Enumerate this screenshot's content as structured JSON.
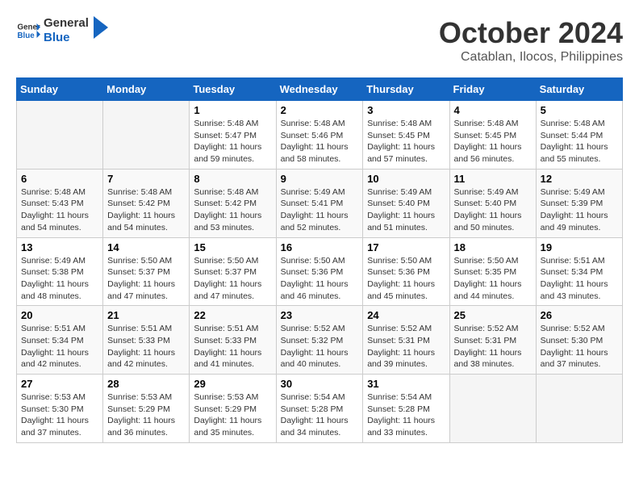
{
  "header": {
    "logo_line1": "General",
    "logo_line2": "Blue",
    "month_year": "October 2024",
    "location": "Catablan, Ilocos, Philippines"
  },
  "weekdays": [
    "Sunday",
    "Monday",
    "Tuesday",
    "Wednesday",
    "Thursday",
    "Friday",
    "Saturday"
  ],
  "weeks": [
    [
      {
        "day": "",
        "info": ""
      },
      {
        "day": "",
        "info": ""
      },
      {
        "day": "1",
        "info": "Sunrise: 5:48 AM\nSunset: 5:47 PM\nDaylight: 11 hours and 59 minutes."
      },
      {
        "day": "2",
        "info": "Sunrise: 5:48 AM\nSunset: 5:46 PM\nDaylight: 11 hours and 58 minutes."
      },
      {
        "day": "3",
        "info": "Sunrise: 5:48 AM\nSunset: 5:45 PM\nDaylight: 11 hours and 57 minutes."
      },
      {
        "day": "4",
        "info": "Sunrise: 5:48 AM\nSunset: 5:45 PM\nDaylight: 11 hours and 56 minutes."
      },
      {
        "day": "5",
        "info": "Sunrise: 5:48 AM\nSunset: 5:44 PM\nDaylight: 11 hours and 55 minutes."
      }
    ],
    [
      {
        "day": "6",
        "info": "Sunrise: 5:48 AM\nSunset: 5:43 PM\nDaylight: 11 hours and 54 minutes."
      },
      {
        "day": "7",
        "info": "Sunrise: 5:48 AM\nSunset: 5:42 PM\nDaylight: 11 hours and 54 minutes."
      },
      {
        "day": "8",
        "info": "Sunrise: 5:48 AM\nSunset: 5:42 PM\nDaylight: 11 hours and 53 minutes."
      },
      {
        "day": "9",
        "info": "Sunrise: 5:49 AM\nSunset: 5:41 PM\nDaylight: 11 hours and 52 minutes."
      },
      {
        "day": "10",
        "info": "Sunrise: 5:49 AM\nSunset: 5:40 PM\nDaylight: 11 hours and 51 minutes."
      },
      {
        "day": "11",
        "info": "Sunrise: 5:49 AM\nSunset: 5:40 PM\nDaylight: 11 hours and 50 minutes."
      },
      {
        "day": "12",
        "info": "Sunrise: 5:49 AM\nSunset: 5:39 PM\nDaylight: 11 hours and 49 minutes."
      }
    ],
    [
      {
        "day": "13",
        "info": "Sunrise: 5:49 AM\nSunset: 5:38 PM\nDaylight: 11 hours and 48 minutes."
      },
      {
        "day": "14",
        "info": "Sunrise: 5:50 AM\nSunset: 5:37 PM\nDaylight: 11 hours and 47 minutes."
      },
      {
        "day": "15",
        "info": "Sunrise: 5:50 AM\nSunset: 5:37 PM\nDaylight: 11 hours and 47 minutes."
      },
      {
        "day": "16",
        "info": "Sunrise: 5:50 AM\nSunset: 5:36 PM\nDaylight: 11 hours and 46 minutes."
      },
      {
        "day": "17",
        "info": "Sunrise: 5:50 AM\nSunset: 5:36 PM\nDaylight: 11 hours and 45 minutes."
      },
      {
        "day": "18",
        "info": "Sunrise: 5:50 AM\nSunset: 5:35 PM\nDaylight: 11 hours and 44 minutes."
      },
      {
        "day": "19",
        "info": "Sunrise: 5:51 AM\nSunset: 5:34 PM\nDaylight: 11 hours and 43 minutes."
      }
    ],
    [
      {
        "day": "20",
        "info": "Sunrise: 5:51 AM\nSunset: 5:34 PM\nDaylight: 11 hours and 42 minutes."
      },
      {
        "day": "21",
        "info": "Sunrise: 5:51 AM\nSunset: 5:33 PM\nDaylight: 11 hours and 42 minutes."
      },
      {
        "day": "22",
        "info": "Sunrise: 5:51 AM\nSunset: 5:33 PM\nDaylight: 11 hours and 41 minutes."
      },
      {
        "day": "23",
        "info": "Sunrise: 5:52 AM\nSunset: 5:32 PM\nDaylight: 11 hours and 40 minutes."
      },
      {
        "day": "24",
        "info": "Sunrise: 5:52 AM\nSunset: 5:31 PM\nDaylight: 11 hours and 39 minutes."
      },
      {
        "day": "25",
        "info": "Sunrise: 5:52 AM\nSunset: 5:31 PM\nDaylight: 11 hours and 38 minutes."
      },
      {
        "day": "26",
        "info": "Sunrise: 5:52 AM\nSunset: 5:30 PM\nDaylight: 11 hours and 37 minutes."
      }
    ],
    [
      {
        "day": "27",
        "info": "Sunrise: 5:53 AM\nSunset: 5:30 PM\nDaylight: 11 hours and 37 minutes."
      },
      {
        "day": "28",
        "info": "Sunrise: 5:53 AM\nSunset: 5:29 PM\nDaylight: 11 hours and 36 minutes."
      },
      {
        "day": "29",
        "info": "Sunrise: 5:53 AM\nSunset: 5:29 PM\nDaylight: 11 hours and 35 minutes."
      },
      {
        "day": "30",
        "info": "Sunrise: 5:54 AM\nSunset: 5:28 PM\nDaylight: 11 hours and 34 minutes."
      },
      {
        "day": "31",
        "info": "Sunrise: 5:54 AM\nSunset: 5:28 PM\nDaylight: 11 hours and 33 minutes."
      },
      {
        "day": "",
        "info": ""
      },
      {
        "day": "",
        "info": ""
      }
    ]
  ]
}
